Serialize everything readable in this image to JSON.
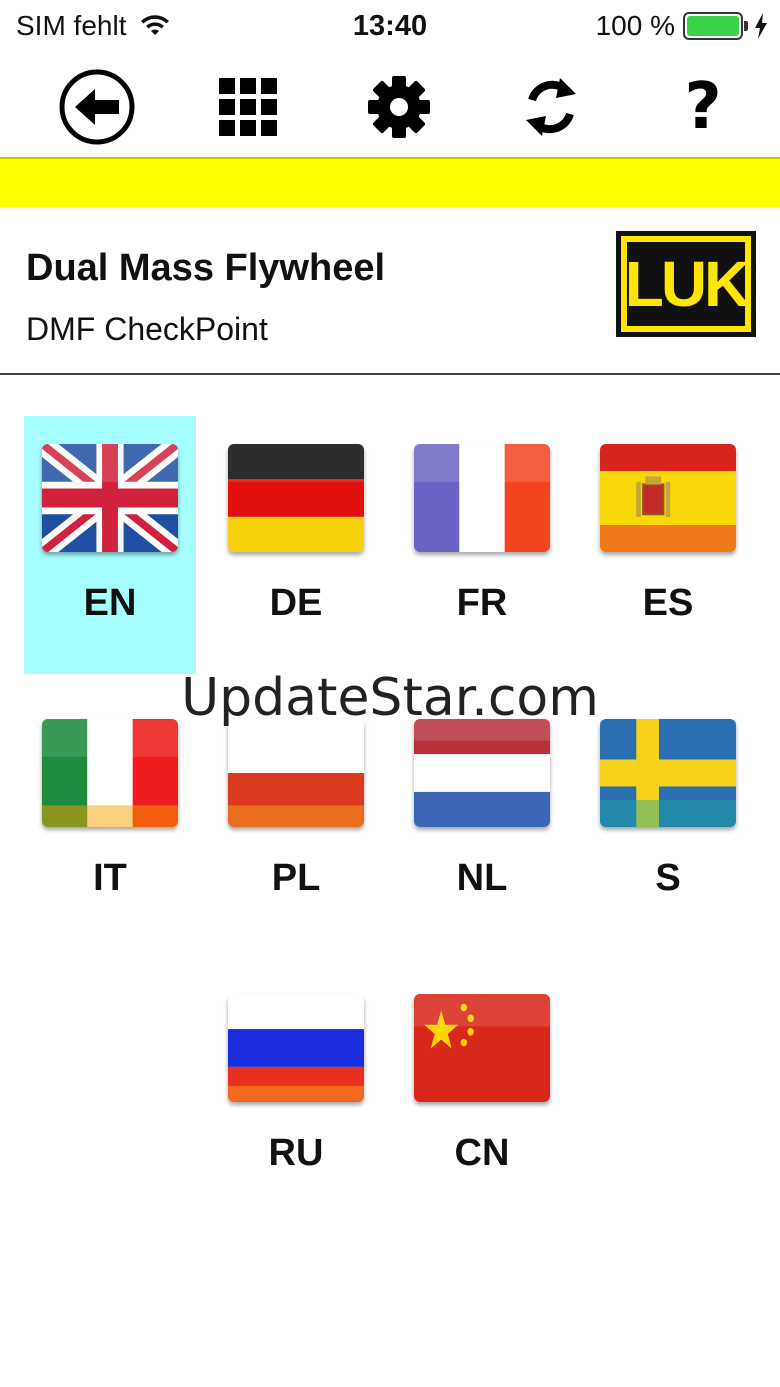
{
  "status_bar": {
    "carrier": "SIM fehlt",
    "time": "13:40",
    "battery": "100 %"
  },
  "toolbar": {
    "help_label": "?"
  },
  "header": {
    "title": "Dual Mass Flywheel",
    "subtitle": "DMF CheckPoint",
    "logo_text": "LUK"
  },
  "languages": [
    {
      "code": "EN",
      "selected": true
    },
    {
      "code": "DE"
    },
    {
      "code": "FR"
    },
    {
      "code": "ES"
    },
    {
      "code": "IT"
    },
    {
      "code": "PL"
    },
    {
      "code": "NL"
    },
    {
      "code": "S"
    },
    {
      "code": "RU"
    },
    {
      "code": "CN"
    }
  ],
  "watermark": "UpdateStar.com",
  "colors": {
    "highlight_bar": "#ffff00",
    "selected_bg": "#a6feff",
    "logo_yellow": "#ffe600"
  }
}
